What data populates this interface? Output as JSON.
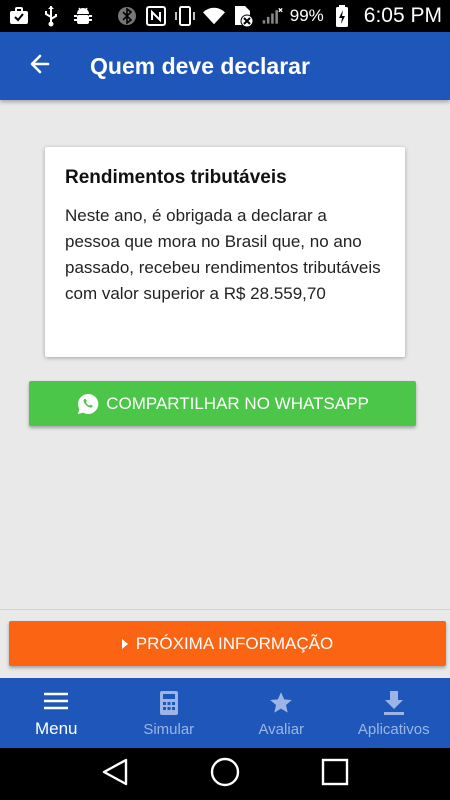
{
  "status_bar": {
    "left_icons": [
      "briefcase-check-icon",
      "usb-icon",
      "android-debug-icon"
    ],
    "right_icons": [
      "bluetooth-icon",
      "nfc-icon",
      "vibrate-icon",
      "wifi-icon",
      "no-sim-icon",
      "signal-icon",
      "battery-charging-icon"
    ],
    "battery": "99%",
    "time": "6:05 PM"
  },
  "app_bar": {
    "title": "Quem deve declarar",
    "back_icon": "arrow-back-icon",
    "color": "#1e56b9"
  },
  "card": {
    "title": "Rendimentos tributáveis",
    "body": "Neste ano, é obrigada a declarar a pessoa que mora no Brasil que, no ano passado, recebeu rendimentos tributáveis com valor superior a R$ 28.559,70"
  },
  "whatsapp_button": {
    "label": "COMPARTILHAR NO WHATSAPP",
    "icon": "whatsapp-icon",
    "color": "#4cc649"
  },
  "next_button": {
    "label": "PRÓXIMA INFORMAÇÃO",
    "icon": "caret-right-icon",
    "color": "#fa6412"
  },
  "bottom_nav": {
    "items": [
      {
        "label": "Menu",
        "icon": "menu-icon",
        "active": true
      },
      {
        "label": "Simular",
        "icon": "calculator-icon",
        "active": false
      },
      {
        "label": "Avaliar",
        "icon": "star-icon",
        "active": false
      },
      {
        "label": "Aplicativos",
        "icon": "download-icon",
        "active": false
      }
    ]
  },
  "system_nav": {
    "buttons": [
      "back-triangle-icon",
      "home-circle-icon",
      "recents-square-icon"
    ]
  }
}
